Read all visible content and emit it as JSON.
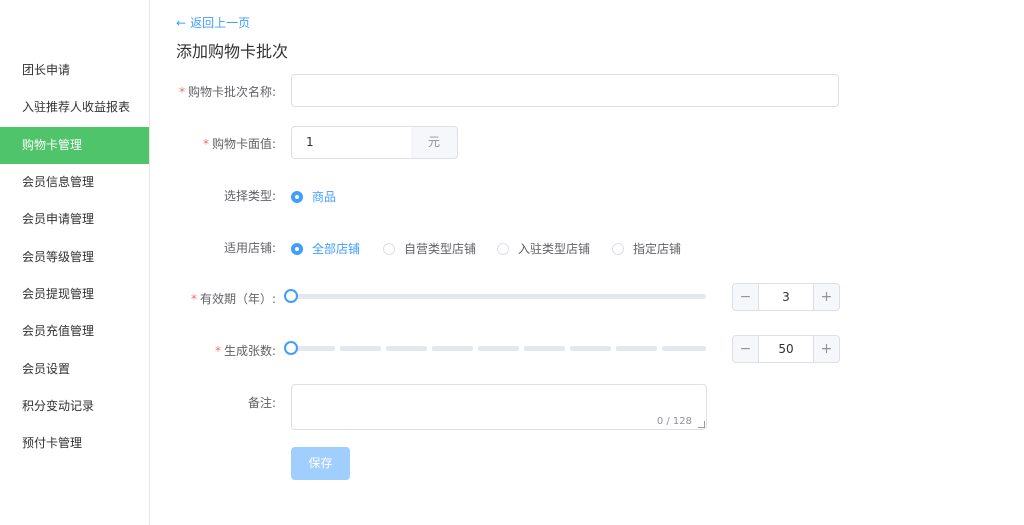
{
  "sidebar": {
    "items": [
      {
        "label": "团长申请",
        "active": false
      },
      {
        "label": "入驻推荐人收益报表",
        "active": false
      },
      {
        "label": "购物卡管理",
        "active": true
      },
      {
        "label": "会员信息管理",
        "active": false
      },
      {
        "label": "会员申请管理",
        "active": false
      },
      {
        "label": "会员等级管理",
        "active": false
      },
      {
        "label": "会员提现管理",
        "active": false
      },
      {
        "label": "会员充值管理",
        "active": false
      },
      {
        "label": "会员设置",
        "active": false
      },
      {
        "label": "积分变动记录",
        "active": false
      },
      {
        "label": "预付卡管理",
        "active": false
      }
    ]
  },
  "header": {
    "back_label": "返回上一页",
    "back_arrow": "←",
    "title": "添加购物卡批次"
  },
  "form": {
    "batch_name": {
      "label": "购物卡批次名称:",
      "required": true,
      "value": "",
      "placeholder": ""
    },
    "face_value": {
      "label": "购物卡面值:",
      "required": true,
      "value": "1",
      "unit": "元"
    },
    "type": {
      "label": "选择类型:",
      "options": [
        {
          "label": "商品",
          "checked": true
        }
      ]
    },
    "stores": {
      "label": "适用店铺:",
      "options": [
        {
          "label": "全部店铺",
          "checked": true
        },
        {
          "label": "自营类型店铺",
          "checked": false
        },
        {
          "label": "入驻类型店铺",
          "checked": false
        },
        {
          "label": "指定店铺",
          "checked": false
        }
      ]
    },
    "validity": {
      "label": "有效期（年）:",
      "required": true,
      "value": "3",
      "minus": "−",
      "plus": "+"
    },
    "quantity": {
      "label": "生成张数:",
      "required": true,
      "value": "50",
      "minus": "−",
      "plus": "+"
    },
    "remark": {
      "label": "备注:",
      "value": "",
      "counter": "0 / 128"
    },
    "save_label": "保存"
  },
  "colors": {
    "accent": "#409eff",
    "active_sidebar": "#4fc46a",
    "required": "#f56c6c",
    "save_disabled": "#a0cfff"
  }
}
